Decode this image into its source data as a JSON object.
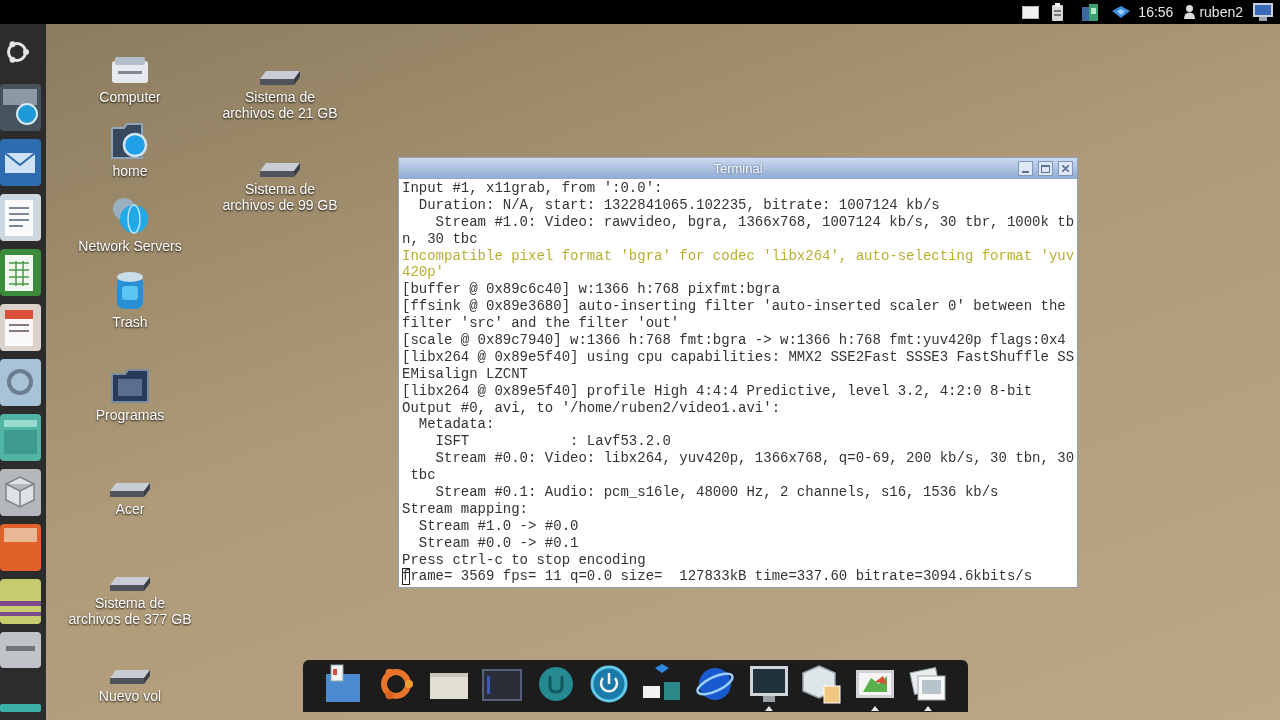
{
  "top_panel": {
    "clock": "16:56",
    "user": "ruben2"
  },
  "desktop_icons": [
    {
      "label": "Computer",
      "kind": "computer"
    },
    {
      "label": "home",
      "kind": "home"
    },
    {
      "label": "Network Servers",
      "kind": "network"
    },
    {
      "label": "Trash",
      "kind": "trash"
    },
    {
      "label": "Programas",
      "kind": "folder"
    },
    {
      "label": "Acer",
      "kind": "drive"
    },
    {
      "label": "Sistema de\narchivos de 377 GB",
      "kind": "drive"
    },
    {
      "label": "Nuevo vol",
      "kind": "drive"
    },
    {
      "label": "Sistema de\narchivos de 21 GB",
      "kind": "drive"
    },
    {
      "label": "Sistema de\narchivos de 99 GB",
      "kind": "drive"
    }
  ],
  "terminal": {
    "title": "Terminal",
    "lines": [
      {
        "text": "Input #1, x11grab, from ':0.0':",
        "kind": "output",
        "cursor": false
      },
      {
        "text": "  Duration: N/A, start: 1322841065.102235, bitrate: 1007124 kb/s",
        "kind": "output",
        "cursor": false
      },
      {
        "text": "    Stream #1.0: Video: rawvideo, bgra, 1366x768, 1007124 kb/s, 30 tbr, 1000k tb",
        "kind": "output",
        "cursor": false
      },
      {
        "text": "n, 30 tbc",
        "kind": "output",
        "cursor": false
      },
      {
        "text": "Incompatible pixel format 'bgra' for codec 'libx264', auto-selecting format 'yuv",
        "kind": "warning",
        "cursor": false
      },
      {
        "text": "420p'",
        "kind": "warning",
        "cursor": false
      },
      {
        "text": "[buffer @ 0x89c6c40] w:1366 h:768 pixfmt:bgra",
        "kind": "output",
        "cursor": false
      },
      {
        "text": "[ffsink @ 0x89e3680] auto-inserting filter 'auto-inserted scaler 0' between the",
        "kind": "output",
        "cursor": false
      },
      {
        "text": "filter 'src' and the filter 'out'",
        "kind": "output",
        "cursor": false
      },
      {
        "text": "[scale @ 0x89c7940] w:1366 h:768 fmt:bgra -> w:1366 h:768 fmt:yuv420p flags:0x4",
        "kind": "output",
        "cursor": false
      },
      {
        "text": "[libx264 @ 0x89e5f40] using cpu capabilities: MMX2 SSE2Fast SSSE3 FastShuffle SS",
        "kind": "output",
        "cursor": false
      },
      {
        "text": "EMisalign LZCNT",
        "kind": "output",
        "cursor": false
      },
      {
        "text": "[libx264 @ 0x89e5f40] profile High 4:4:4 Predictive, level 3.2, 4:2:0 8-bit",
        "kind": "output",
        "cursor": false
      },
      {
        "text": "Output #0, avi, to '/home/ruben2/video1.avi':",
        "kind": "output",
        "cursor": false
      },
      {
        "text": "  Metadata:",
        "kind": "output",
        "cursor": false
      },
      {
        "text": "    ISFT            : Lavf53.2.0",
        "kind": "output",
        "cursor": false
      },
      {
        "text": "    Stream #0.0: Video: libx264, yuv420p, 1366x768, q=0-69, 200 kb/s, 30 tbn, 30",
        "kind": "output",
        "cursor": false
      },
      {
        "text": " tbc",
        "kind": "output",
        "cursor": false
      },
      {
        "text": "    Stream #0.1: Audio: pcm_s16le, 48000 Hz, 2 channels, s16, 1536 kb/s",
        "kind": "output",
        "cursor": false
      },
      {
        "text": "Stream mapping:",
        "kind": "output",
        "cursor": false
      },
      {
        "text": "  Stream #1.0 -> #0.0",
        "kind": "output",
        "cursor": false
      },
      {
        "text": "  Stream #0.0 -> #0.1",
        "kind": "output",
        "cursor": false
      },
      {
        "text": "Press ctrl-c to stop encoding",
        "kind": "output",
        "cursor": false
      },
      {
        "text": "frame= 3569 fps= 11 q=0.0 size=  127833kB time=337.60 bitrate=3094.6kbits/s",
        "kind": "output",
        "cursor": true
      }
    ]
  },
  "dock": {
    "items": [
      {
        "kind": "document",
        "running": false
      },
      {
        "kind": "ring-logo",
        "running": false
      },
      {
        "kind": "window",
        "running": false
      },
      {
        "kind": "screen",
        "running": false
      },
      {
        "kind": "circle",
        "running": false
      },
      {
        "kind": "power",
        "running": false
      },
      {
        "kind": "network",
        "running": false
      },
      {
        "kind": "browser",
        "running": false
      },
      {
        "kind": "monitor",
        "running": true
      },
      {
        "kind": "cube",
        "running": false
      },
      {
        "kind": "image",
        "running": true
      },
      {
        "kind": "photos",
        "running": true
      }
    ]
  }
}
